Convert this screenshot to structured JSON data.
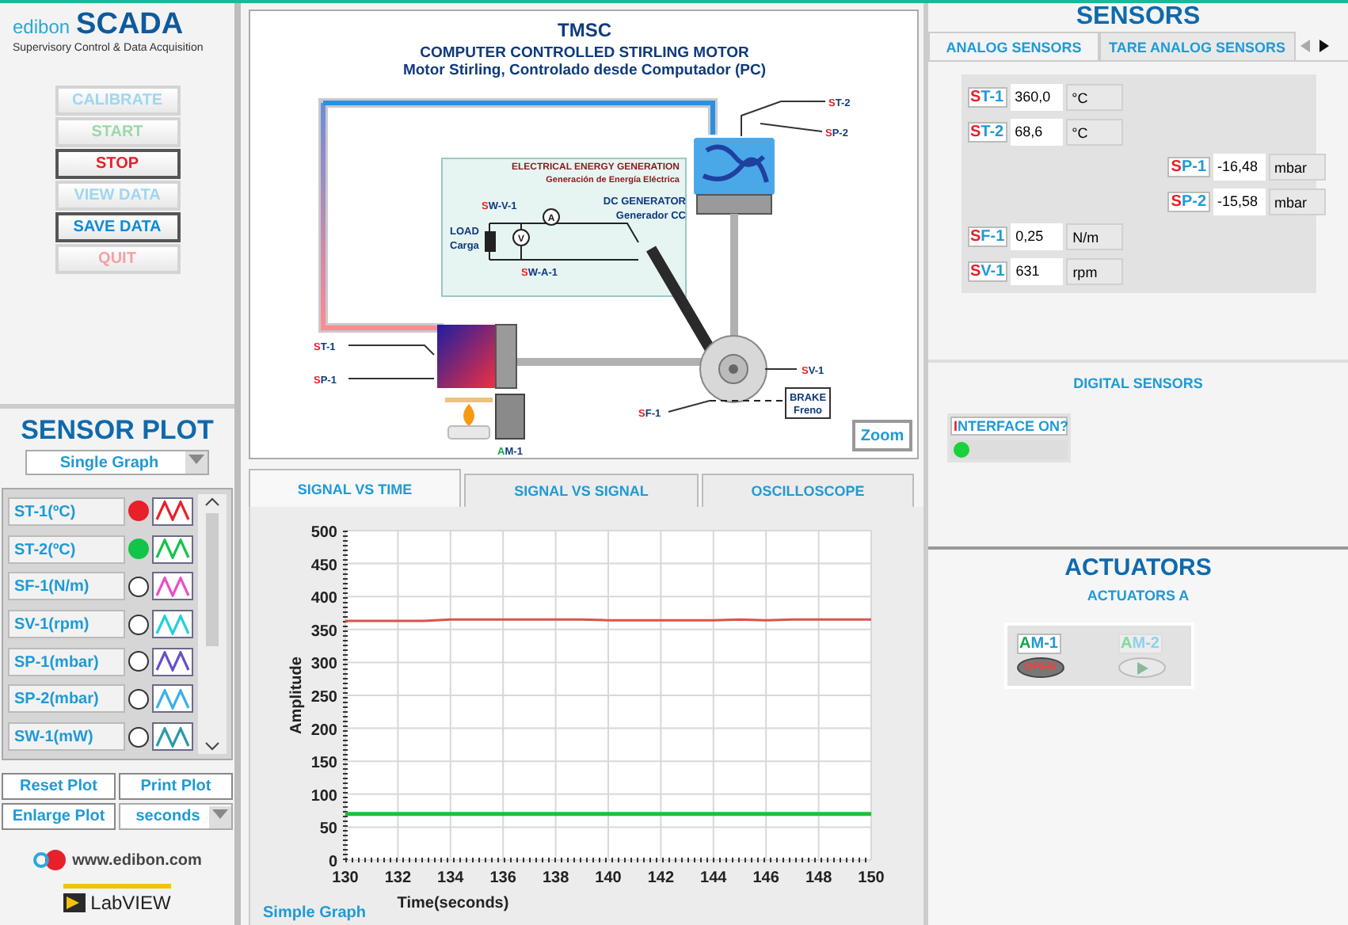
{
  "header": {
    "logo": "edibon",
    "title": "SCADA",
    "subtitle": "Supervisory Control & Data Acquisition"
  },
  "control_buttons": [
    {
      "label": "CALIBRATE",
      "disabled": true,
      "color": "#9fd6f2"
    },
    {
      "label": "START",
      "disabled": true,
      "color": "#9cd9a8"
    },
    {
      "label": "STOP",
      "disabled": false,
      "color": "#e8202a"
    },
    {
      "label": "VIEW DATA",
      "disabled": true,
      "color": "#9fd6f2"
    },
    {
      "label": "SAVE DATA",
      "disabled": false,
      "color": "#0e8bd8"
    },
    {
      "label": "QUIT",
      "disabled": true,
      "color": "#f5a0a4"
    }
  ],
  "sensor_plot": {
    "title": "SENSOR PLOT",
    "mode": "Single Graph",
    "channels": [
      {
        "label": "ST-1(ºC)",
        "on": true,
        "color": "#e8202a"
      },
      {
        "label": "ST-2(ºC)",
        "on": true,
        "color": "#13c44a"
      },
      {
        "label": "SF-1(N/m)",
        "on": false,
        "color": "#e84fc8"
      },
      {
        "label": "SV-1(rpm)",
        "on": false,
        "color": "#22d0e0"
      },
      {
        "label": "SP-1(mbar)",
        "on": false,
        "color": "#6a4fc8"
      },
      {
        "label": "SP-2(mbar)",
        "on": false,
        "color": "#3ab0e8"
      },
      {
        "label": "SW-1(mW)",
        "on": false,
        "color": "#2a9aa8"
      }
    ],
    "buttons": [
      "Reset Plot",
      "Print Plot",
      "Enlarge Plot"
    ],
    "time_unit": "seconds"
  },
  "footer": {
    "website": "www.edibon.com",
    "logo_text": "LabVIEW"
  },
  "diagram": {
    "title": "TMSC",
    "subtitle": "COMPUTER CONTROLLED STIRLING MOTOR",
    "subtitle_es": "Motor Stirling, Controlado desde Computador (PC)",
    "inset_title": "ELECTRICAL ENERGY GENERATION",
    "inset_subtitle": "Generación de Energía Eléctrica",
    "meters": [
      "A",
      "V"
    ],
    "labels": [
      {
        "text": "ST-2",
        "kind": "sensor"
      },
      {
        "text": "SP-2",
        "kind": "sensor"
      },
      {
        "text": "SW-V-1",
        "kind": "sensor"
      },
      {
        "text": "DC GENERATOR",
        "kind": "note"
      },
      {
        "text": "Generador CC",
        "kind": "note"
      },
      {
        "text": "LOAD",
        "kind": "note"
      },
      {
        "text": "Carga",
        "kind": "note"
      },
      {
        "text": "SW-A-1",
        "kind": "sensor"
      },
      {
        "text": "ST-1",
        "kind": "sensor"
      },
      {
        "text": "SP-1",
        "kind": "sensor"
      },
      {
        "text": "SV-1",
        "kind": "sensor"
      },
      {
        "text": "SF-1",
        "kind": "sensor"
      },
      {
        "text": "BRAKE",
        "kind": "note"
      },
      {
        "text": "Freno",
        "kind": "note"
      },
      {
        "text": "AM-1",
        "kind": "actuator"
      }
    ],
    "zoom_button": "Zoom"
  },
  "plot_tabs": [
    {
      "label": "SIGNAL VS TIME",
      "selected": true
    },
    {
      "label": "SIGNAL VS SIGNAL",
      "selected": false
    },
    {
      "label": "OSCILLOSCOPE",
      "selected": false
    }
  ],
  "graph": {
    "caption": "Simple Graph",
    "chart_data": {
      "type": "line",
      "xlabel": "Time(seconds)",
      "ylabel": "Amplitude",
      "x": [
        130,
        131,
        132,
        133,
        134,
        135,
        136,
        137,
        138,
        139,
        140,
        141,
        142,
        143,
        144,
        145,
        146,
        147,
        148,
        149,
        150
      ],
      "series": [
        {
          "color": "#d9534f",
          "values": [
            363,
            363,
            363,
            363,
            365,
            365,
            365,
            365,
            365,
            365,
            364,
            364,
            364,
            364,
            364,
            365,
            364,
            365,
            365,
            365,
            365
          ]
        },
        {
          "color": "#19c23a",
          "values": [
            70,
            70,
            70,
            70,
            70,
            70,
            70,
            70,
            70,
            70,
            70,
            70,
            70,
            70,
            70,
            70,
            70,
            70,
            70,
            70,
            70
          ]
        }
      ],
      "grid": true,
      "xlim": [
        130,
        150
      ],
      "ylim": [
        0,
        500
      ],
      "xticks": [
        130,
        132,
        134,
        136,
        138,
        140,
        142,
        144,
        146,
        148,
        150
      ],
      "yticks": [
        0,
        50,
        100,
        150,
        200,
        250,
        300,
        350,
        400,
        450,
        500
      ]
    }
  },
  "sensors": {
    "title": "SENSORS",
    "tabs": [
      {
        "label": "ANALOG SENSORS",
        "selected": true
      },
      {
        "label": "TARE ANALOG SENSORS",
        "selected": false
      }
    ],
    "readings": [
      {
        "tag": "ST-1",
        "value": "360,0",
        "unit": "°C"
      },
      {
        "tag": "ST-2",
        "value": "68,6",
        "unit": "°C"
      },
      {
        "tag": "SP-1",
        "value": "-16,48",
        "unit": "mbar"
      },
      {
        "tag": "SP-2",
        "value": "-15,58",
        "unit": "mbar"
      },
      {
        "tag": "SF-1",
        "value": "0,25",
        "unit": "N/m"
      },
      {
        "tag": "SV-1",
        "value": "631",
        "unit": "rpm"
      }
    ],
    "digital_title": "DIGITAL SENSORS",
    "digital": [
      {
        "label": "INTERFACE ON?",
        "on": true
      }
    ]
  },
  "actuators": {
    "title": "ACTUATORS",
    "group": "ACTUATORS A",
    "items": [
      {
        "label": "AM-1",
        "disabled": false,
        "on": true,
        "button_text": "OPEN"
      },
      {
        "label": "AM-2",
        "disabled": true,
        "on": false
      }
    ]
  }
}
